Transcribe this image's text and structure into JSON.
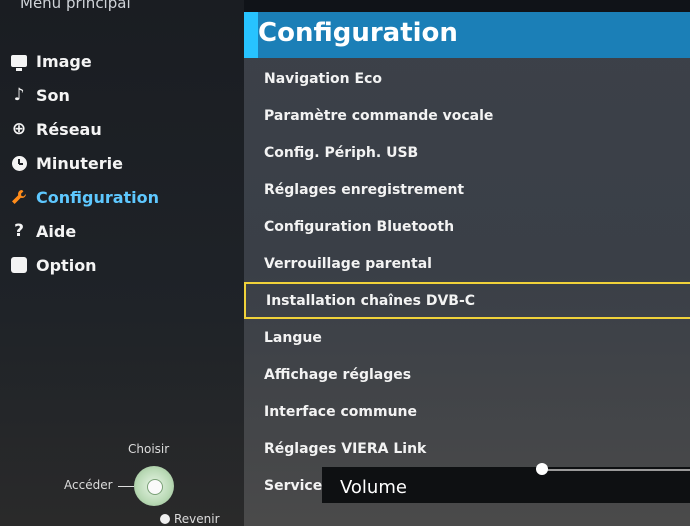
{
  "menu": {
    "title": "Menu principal",
    "items": [
      {
        "label": "Image",
        "icon": "screen-icon"
      },
      {
        "label": "Son",
        "icon": "music-note-icon"
      },
      {
        "label": "Réseau",
        "icon": "globe-icon"
      },
      {
        "label": "Minuterie",
        "icon": "clock-icon"
      },
      {
        "label": "Configuration",
        "icon": "wrench-icon",
        "active": true
      },
      {
        "label": "Aide",
        "icon": "question-icon"
      },
      {
        "label": "Option",
        "icon": "square-icon"
      }
    ]
  },
  "hints": {
    "choose": "Choisir",
    "access": "Accéder",
    "back": "Revenir"
  },
  "config": {
    "title": "Configuration",
    "items": [
      "Navigation Eco",
      "Paramètre commande vocale",
      "Config. Périph. USB",
      "Réglages enregistrement",
      "Configuration Bluetooth",
      "Verrouillage parental",
      "Installation chaînes DVB-C",
      "Langue",
      "Affichage réglages",
      "Interface commune",
      "Réglages VIERA Link",
      "Service numérique"
    ],
    "selected_index": 6
  },
  "volume": {
    "label": "Volume"
  },
  "colors": {
    "accent": "#27c3ff",
    "header": "#1b7fb7",
    "active_menu": "#5ec8ff",
    "selection": "#f0d23a"
  }
}
